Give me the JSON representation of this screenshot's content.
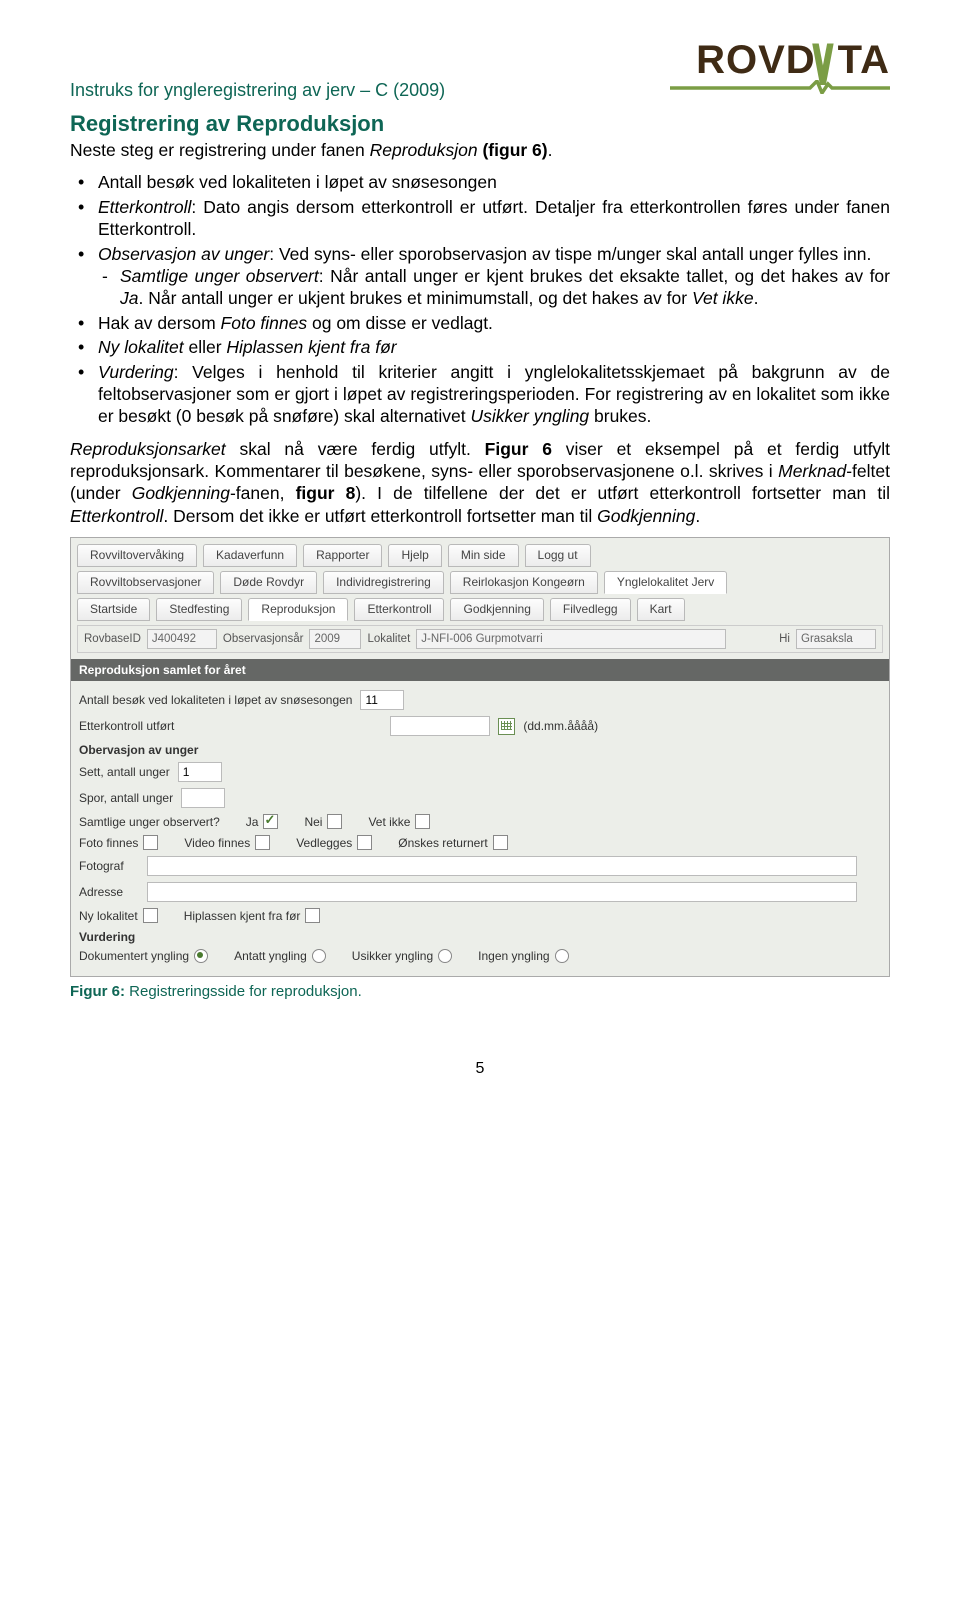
{
  "header": {
    "doc_title": "Instruks for yngleregistrering av jerv – C (2009)",
    "logo_text": "ROVD  TA"
  },
  "section_title": "Registrering av Reproduksjon",
  "intro": "Neste steg er registrering under fanen Reproduksjon (figur 6).",
  "bullets": {
    "b1": "Antall besøk ved lokaliteten i løpet av snøsesongen",
    "b2a": "Etterkontroll",
    "b2b": ": Dato angis dersom etterkontroll er utført. Detaljer fra etterkontrollen føres under fanen Etterkontroll.",
    "b3a": "Observasjon av unger",
    "b3b": ": Ved syns- eller sporobservasjon av tispe m/unger skal antall unger fylles inn.",
    "b3_sub_a": "Samtlige unger observert",
    "b3_sub_b": ": Når antall unger er kjent brukes det eksakte tallet, og det hakes av for ",
    "b3_sub_c": "Ja",
    "b3_sub_d": ". Når antall unger er ukjent brukes et minimumstall, og det hakes av for ",
    "b3_sub_e": "Vet ikke",
    "b3_sub_f": ".",
    "b4a": "Hak av dersom ",
    "b4b": "Foto finnes",
    "b4c": " og om disse er vedlagt.",
    "b5a": "Ny lokalitet",
    "b5b": " eller ",
    "b5c": "Hiplassen kjent fra før",
    "b6a": "Vurdering",
    "b6b": ": Velges i henhold til kriterier angitt i ynglelokalitetsskjemaet på bakgrunn av de feltobservasjoner som er gjort i løpet av registreringsperioden. For registrering av en lokalitet som ikke er besøkt (0 besøk på snøføre) skal alternativet ",
    "b6c": "Usikker yngling",
    "b6d": " brukes."
  },
  "para2a": "Reproduksjonsarket",
  "para2b": " skal nå være ferdig utfylt. ",
  "para2c": "Figur 6",
  "para2d": " viser et eksempel på et ferdig utfylt reproduksjonsark. Kommentarer til besøkene, syns- eller sporobservasjonene o.l. skrives i ",
  "para2e": "Merknad",
  "para2f": "-feltet (under ",
  "para2g": "Godkjenning",
  "para2h": "-fanen, ",
  "para2i": "figur 8",
  "para2j": "). I de tilfellene der det er utført etterkontroll fortsetter man til ",
  "para2k": "Etterkontroll",
  "para2l": ". Dersom det ikke er utført etterkontroll fortsetter man til ",
  "para2m": "Godkjenning",
  "para2n": ".",
  "form": {
    "tabs1": [
      "Rovviltovervåking",
      "Kadaverfunn",
      "Rapporter",
      "Hjelp",
      "Min side",
      "Logg ut"
    ],
    "tabs2": [
      "Rovviltobservasjoner",
      "Døde Rovdyr",
      "Individregistrering",
      "Reirlokasjon Kongeørn",
      "Ynglelokalitet Jerv"
    ],
    "tabs3": [
      "Startside",
      "Stedfesting",
      "Reproduksjon",
      "Etterkontroll",
      "Godkjenning",
      "Filvedlegg",
      "Kart"
    ],
    "info": {
      "rovbase_lbl": "RovbaseID",
      "rovbase_val": "J400492",
      "aar_lbl": "Observasjonsår",
      "aar_val": "2009",
      "lokalitet_lbl": "Lokalitet",
      "lokalitet_val": "J-NFI-006 Gurpmotvarri",
      "hi_lbl": "Hi",
      "hi_val": "Grasaksla"
    },
    "band1": "Reproduksjon samlet for året",
    "besok_lbl": "Antall besøk ved lokaliteten i løpet av snøsesongen",
    "besok_val": "11",
    "etterkontroll_lbl": "Etterkontroll utført",
    "dateformat": "(dd.mm.åååå)",
    "sec_obs": "Obervasjon av unger",
    "sett_lbl": "Sett, antall unger",
    "sett_val": "1",
    "spor_lbl": "Spor, antall unger",
    "samtlige_lbl": "Samtlige unger observert?",
    "ja": "Ja",
    "nei": "Nei",
    "vetikke": "Vet ikke",
    "foto_finnes": "Foto finnes",
    "video_finnes": "Video finnes",
    "vedlegges": "Vedlegges",
    "onskes_ret": "Ønskes returnert",
    "fotograf": "Fotograf",
    "adresse": "Adresse",
    "ny_lok": "Ny lokalitet",
    "hipl": "Hiplassen kjent fra før",
    "sec_vurd": "Vurdering",
    "v1": "Dokumentert yngling",
    "v2": "Antatt yngling",
    "v3": "Usikker yngling",
    "v4": "Ingen yngling"
  },
  "caption_a": "Figur 6:",
  "caption_b": " Registreringsside for reproduksjon.",
  "page_num": "5"
}
